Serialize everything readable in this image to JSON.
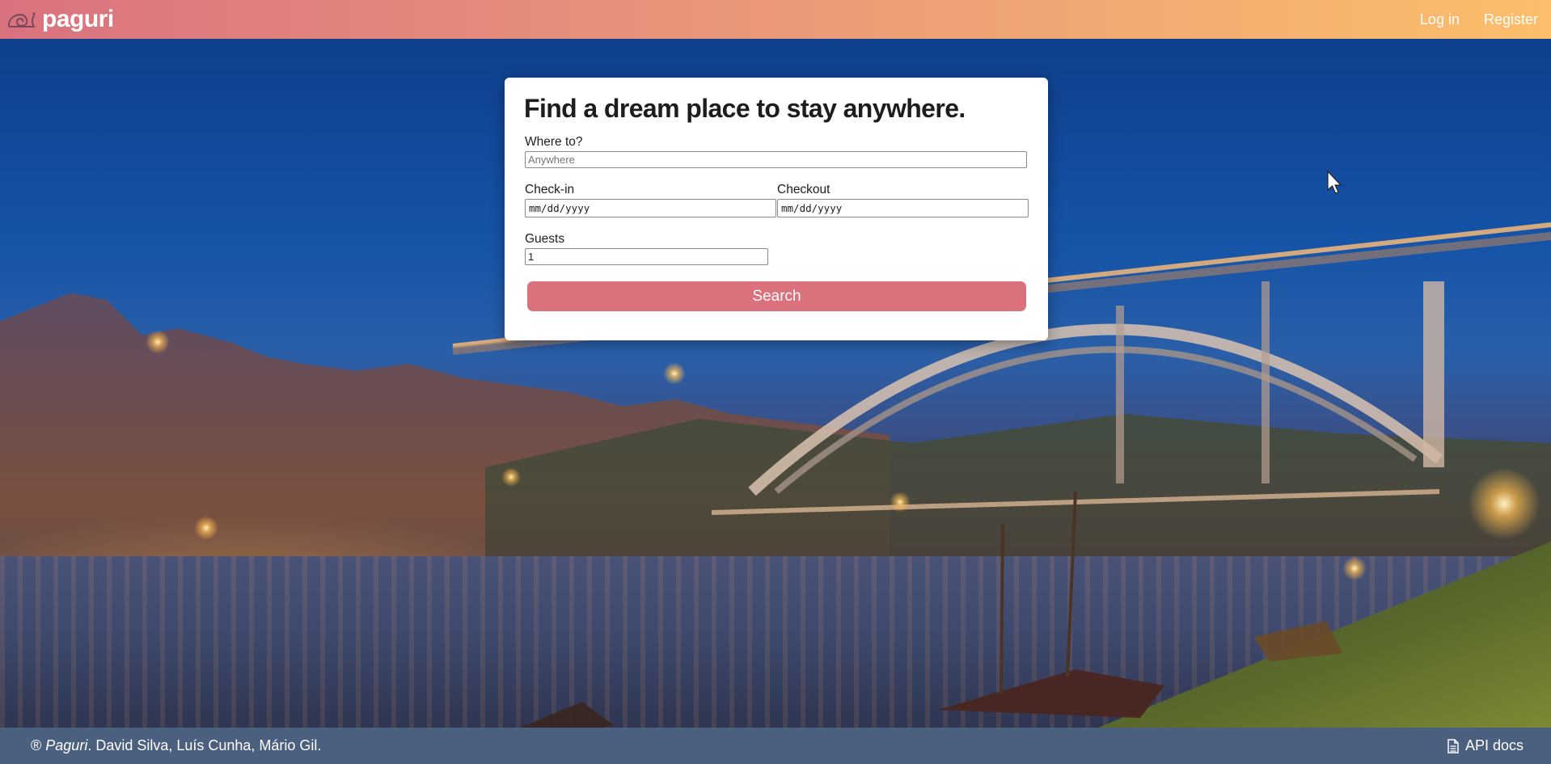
{
  "header": {
    "brand_name": "paguri",
    "brand_icon": "snail-shell-icon",
    "nav": [
      {
        "label": "Log in"
      },
      {
        "label": "Register"
      }
    ]
  },
  "search_card": {
    "heading": "Find a dream place to stay anywhere.",
    "where_label": "Where to?",
    "where_placeholder": "Anywhere",
    "where_value": "",
    "checkin_label": "Check-in",
    "checkin_value": "mm/dd/yyyy",
    "checkout_label": "Checkout",
    "checkout_value": "mm/dd/yyyy",
    "guests_label": "Guests",
    "guests_value": "1",
    "search_button_label": "Search",
    "accent_color": "#da717d"
  },
  "footer": {
    "copyright_symbol": "®",
    "project_name": "Paguri",
    "authors": ". David Silva, Luís Cunha, Mário Gil.",
    "api_docs_label": "API docs",
    "api_docs_icon": "document-icon",
    "background_color": "#4b5f7f"
  },
  "colors": {
    "header_gradient_start": "#d9727f",
    "header_gradient_end": "#fcbe6b"
  }
}
